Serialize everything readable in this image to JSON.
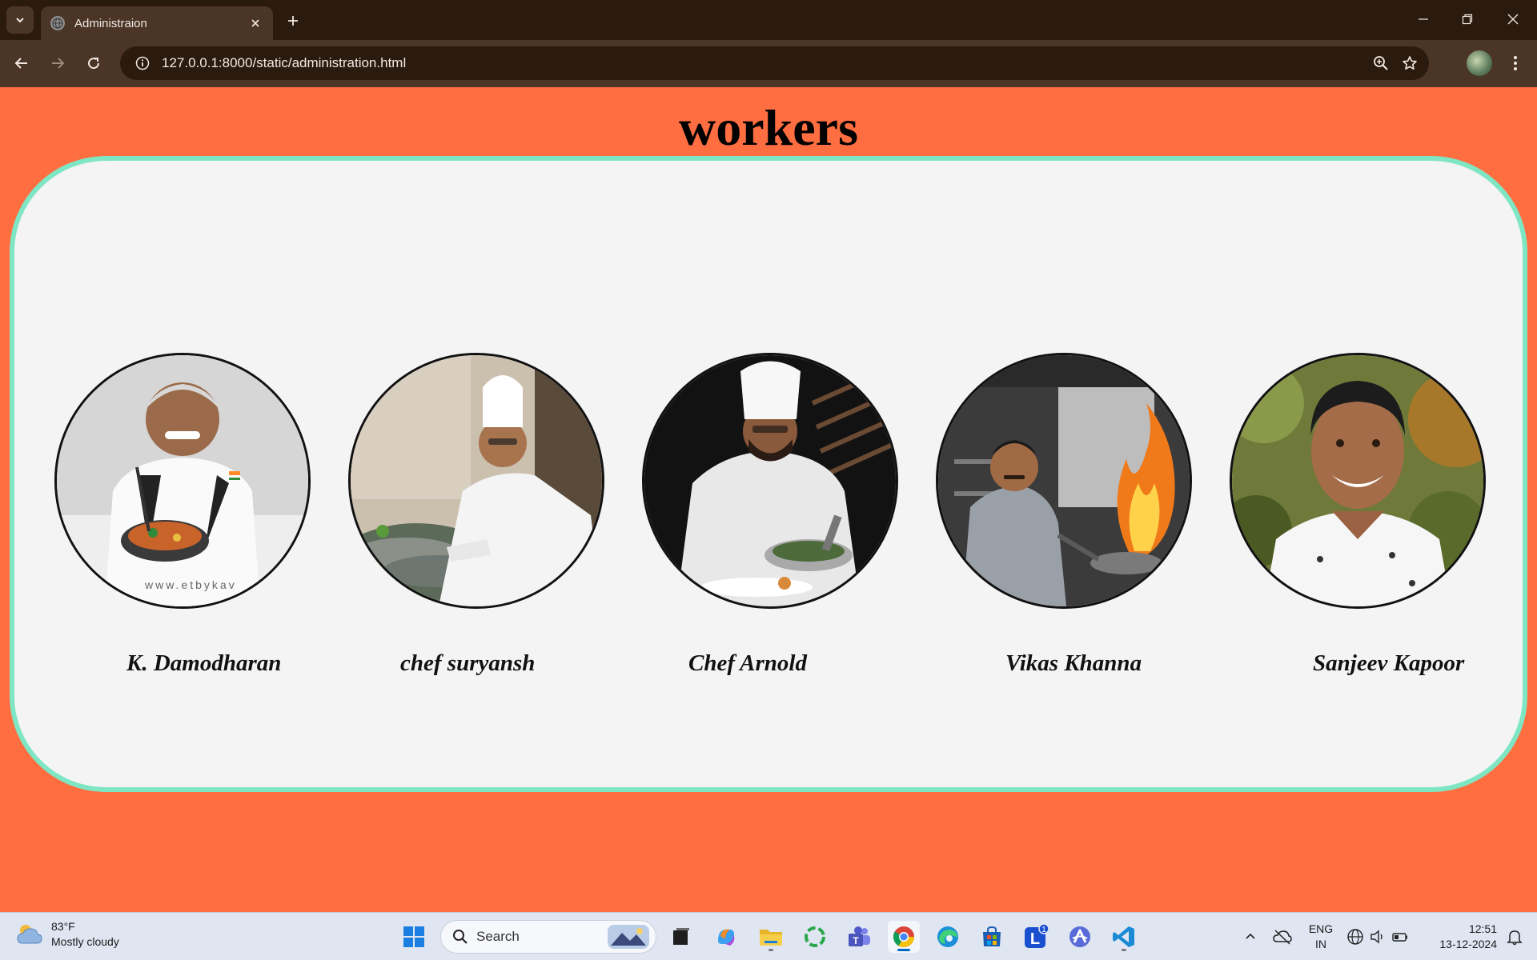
{
  "browser": {
    "tab_title": "Administraion",
    "url": "127.0.0.1:8000/static/administration.html"
  },
  "page": {
    "title": "workers",
    "workers": [
      {
        "name": "K. Damodharan",
        "photo_watermark": "www.etbykav"
      },
      {
        "name": "chef suryansh"
      },
      {
        "name": "Chef Arnold"
      },
      {
        "name": "Vikas Khanna"
      },
      {
        "name": "Sanjeev Kapoor"
      }
    ]
  },
  "colors": {
    "page_background": "#ff6e40",
    "card_background": "#f4f4f4",
    "card_border": "#7fe6c4",
    "browser_frame": "#2b1a0e",
    "toolbar": "#4a3526"
  },
  "taskbar": {
    "weather_temp": "83°F",
    "weather_desc": "Mostly cloudy",
    "search_placeholder": "Search",
    "lang_line1": "ENG",
    "lang_line2": "IN",
    "time": "12:51",
    "date": "13-12-2024",
    "notification_badge": "1",
    "pinned_apps": [
      "start-icon",
      "search-icon",
      "task-view-icon",
      "copilot-icon",
      "file-explorer-icon",
      "sync-app-icon",
      "teams-icon",
      "chrome-icon",
      "edge-icon",
      "store-icon",
      "app-l-icon",
      "arc-icon",
      "vscode-icon"
    ]
  }
}
